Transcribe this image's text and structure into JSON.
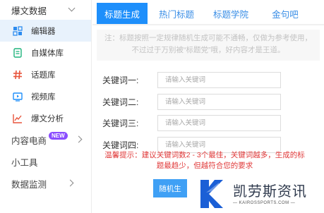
{
  "sidebar": {
    "group1": {
      "label": "爆文数据"
    },
    "items": [
      {
        "label": "编辑器",
        "icon": "editor-icon",
        "active": true
      },
      {
        "label": "自媒体库",
        "icon": "media-library-icon"
      },
      {
        "label": "话题库",
        "icon": "hashtag-icon"
      },
      {
        "label": "视频库",
        "icon": "video-icon"
      },
      {
        "label": "爆文分析",
        "icon": "chart-icon"
      }
    ],
    "ecommerce": {
      "label": "内容电商",
      "badge": "NEW"
    },
    "tools": {
      "label": "小工具"
    },
    "monitor": {
      "label": "数据监测"
    }
  },
  "tabs": [
    {
      "label": "标题生成",
      "active": true
    },
    {
      "label": "热门标题"
    },
    {
      "label": "标题学院"
    },
    {
      "label": "金句吧"
    }
  ],
  "notice": "注：标题按照一定规律随机生成可能不通畅，仅做为参考使用，不过过于万别被“标题党”哦，好内容才是王道。",
  "form": {
    "fields": [
      {
        "label": "关键词一:",
        "placeholder": "请输入关键词"
      },
      {
        "label": "关键词二:",
        "placeholder": "请输入关键词"
      },
      {
        "label": "关键词三:",
        "placeholder": "请输入关键词"
      },
      {
        "label": "关键词四:",
        "placeholder": "请输入关键词"
      }
    ]
  },
  "tip": "温馨提示：建议关键词数2 - 3个最佳，关键词越多，生成的标题最趋少，但越符合您的要求",
  "generate_button": "随机生",
  "watermark": {
    "cn": "凯劳斯资讯",
    "en": "— KAIROSSPORTS.COM —"
  },
  "colors": {
    "accent": "#1e8ffb",
    "tip_red": "#e03a3a",
    "sidebar_active_bg": "#e8f2fc",
    "badge_purple": "#8a4dff"
  }
}
